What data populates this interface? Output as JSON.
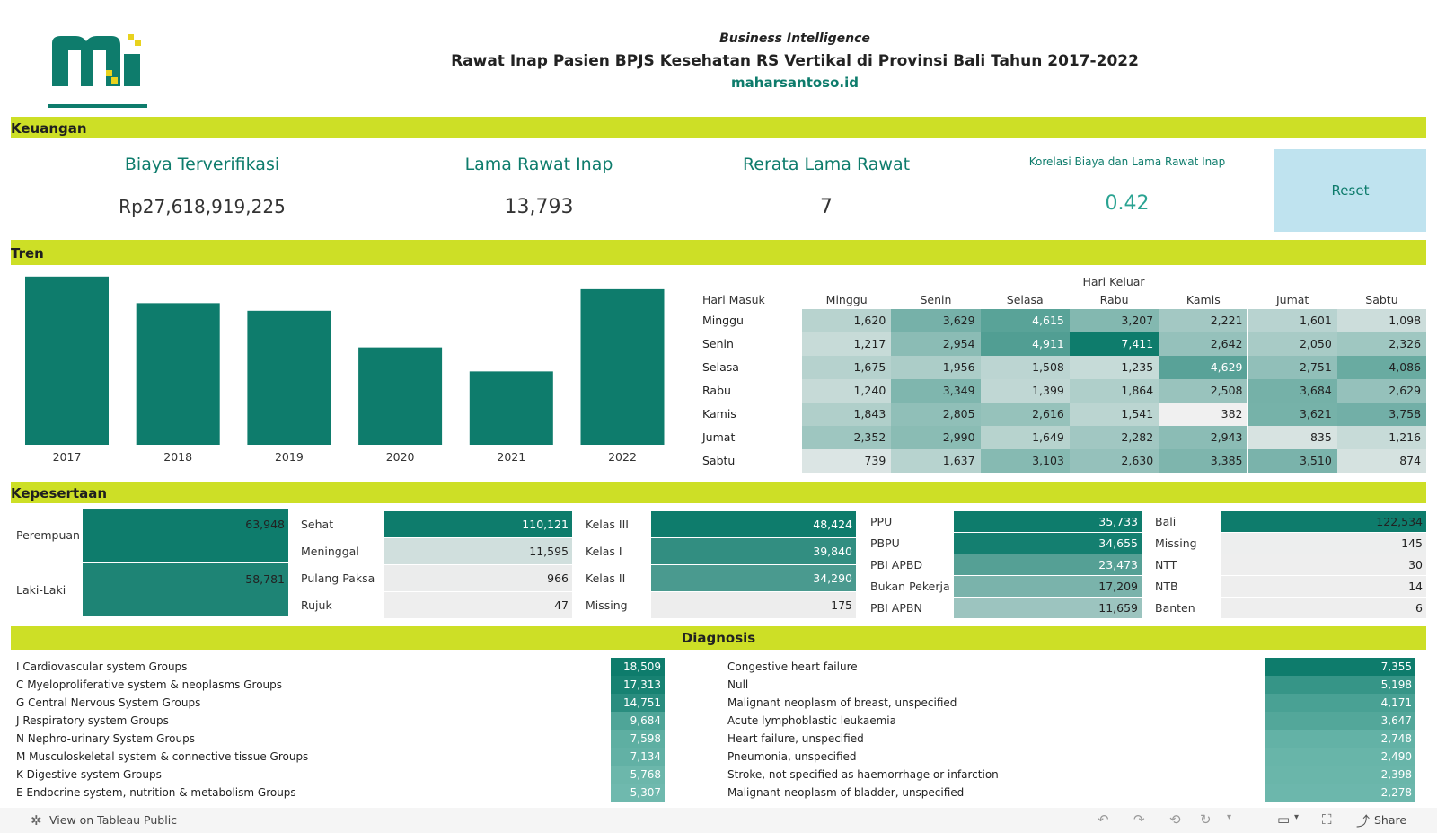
{
  "header": {
    "kicker": "Business Intelligence",
    "title": "Rawat Inap Pasien BPJS Kesehatan RS Vertikal di Provinsi Bali Tahun 2017-2022",
    "site": "maharsantoso.id"
  },
  "colors": {
    "accent": "#0e7c6c",
    "band": "#cddf26",
    "reset_bg": "#bfe3ef"
  },
  "sections": {
    "keuangan": "Keuangan",
    "tren": "Tren",
    "kepesertaan": "Kepesertaan",
    "diagnosis": "Diagnosis"
  },
  "kpi": {
    "biaya": {
      "label": "Biaya Terverifikasi",
      "value": "Rp27,618,919,225"
    },
    "lama": {
      "label": "Lama Rawat Inap",
      "value": "13,793"
    },
    "rerata": {
      "label": "Rerata Lama Rawat",
      "value": "7"
    },
    "korelasi": {
      "label": "Korelasi Biaya dan Lama Rawat Inap",
      "value": "0.42"
    },
    "reset": "Reset"
  },
  "chart_data": [
    {
      "type": "bar",
      "categories": [
        "2017",
        "2018",
        "2019",
        "2020",
        "2021",
        "2022"
      ],
      "values": [
        2660,
        2240,
        2120,
        1540,
        1160,
        2460
      ],
      "ylim": [
        0,
        2700
      ],
      "xlabel": "",
      "ylabel": ""
    },
    {
      "type": "heatmap",
      "title": "Hari Keluar",
      "ylabel": "Hari Masuk",
      "columns": [
        "Minggu",
        "Senin",
        "Selasa",
        "Rabu",
        "Kamis",
        "Jumat",
        "Sabtu"
      ],
      "rows": [
        "Minggu",
        "Senin",
        "Selasa",
        "Rabu",
        "Kamis",
        "Jumat",
        "Sabtu"
      ],
      "values": [
        [
          1620,
          3629,
          4615,
          3207,
          2221,
          1601,
          1098
        ],
        [
          1217,
          2954,
          4911,
          7411,
          2642,
          2050,
          2326
        ],
        [
          1675,
          1956,
          1508,
          1235,
          4629,
          2751,
          4086
        ],
        [
          1240,
          3349,
          1399,
          1864,
          2508,
          3684,
          2629
        ],
        [
          1843,
          2805,
          2616,
          1541,
          382,
          3621,
          3758
        ],
        [
          2352,
          2990,
          1649,
          2282,
          2943,
          835,
          1216
        ],
        [
          739,
          1637,
          3103,
          2630,
          3385,
          3510,
          874
        ]
      ],
      "labels": [
        [
          "1,620",
          "3,629",
          "4,615",
          "3,207",
          "2,221",
          "1,601",
          "1,098"
        ],
        [
          "1,217",
          "2,954",
          "4,911",
          "7,411",
          "2,642",
          "2,050",
          "2,326"
        ],
        [
          "1,675",
          "1,956",
          "1,508",
          "1,235",
          "4,629",
          "2,751",
          "4,086"
        ],
        [
          "1,240",
          "3,349",
          "1,399",
          "1,864",
          "2,508",
          "3,684",
          "2,629"
        ],
        [
          "1,843",
          "2,805",
          "2,616",
          "1,541",
          "382",
          "3,621",
          "3,758"
        ],
        [
          "2,352",
          "2,990",
          "1,649",
          "2,282",
          "2,943",
          "835",
          "1,216"
        ],
        [
          "739",
          "1,637",
          "3,103",
          "2,630",
          "3,385",
          "3,510",
          "874"
        ]
      ]
    }
  ],
  "kepesertaan": {
    "gender": [
      {
        "label": "Perempuan",
        "value": 63948,
        "text": "63,948"
      },
      {
        "label": "Laki-Laki",
        "value": 58781,
        "text": "58,781"
      }
    ],
    "status": [
      {
        "label": "Sehat",
        "value": 110121,
        "text": "110,121"
      },
      {
        "label": "Meninggal",
        "value": 11595,
        "text": "11,595"
      },
      {
        "label": "Pulang Paksa",
        "value": 966,
        "text": "966"
      },
      {
        "label": "Rujuk",
        "value": 47,
        "text": "47"
      }
    ],
    "kelas": [
      {
        "label": "Kelas III",
        "value": 48424,
        "text": "48,424"
      },
      {
        "label": "Kelas I",
        "value": 39840,
        "text": "39,840"
      },
      {
        "label": "Kelas II",
        "value": 34290,
        "text": "34,290"
      },
      {
        "label": "Missing",
        "value": 175,
        "text": "175"
      }
    ],
    "segmen": [
      {
        "label": "PPU",
        "value": 35733,
        "text": "35,733"
      },
      {
        "label": "PBPU",
        "value": 34655,
        "text": "34,655"
      },
      {
        "label": "PBI APBD",
        "value": 23473,
        "text": "23,473"
      },
      {
        "label": "Bukan Pekerja",
        "value": 17209,
        "text": "17,209"
      },
      {
        "label": "PBI APBN",
        "value": 11659,
        "text": "11,659"
      }
    ],
    "provinsi": [
      {
        "label": "Bali",
        "value": 122534,
        "text": "122,534"
      },
      {
        "label": "Missing",
        "value": 145,
        "text": "145"
      },
      {
        "label": "NTT",
        "value": 30,
        "text": "30"
      },
      {
        "label": "NTB",
        "value": 14,
        "text": "14"
      },
      {
        "label": "Banten",
        "value": 6,
        "text": "6"
      }
    ]
  },
  "diagnosis": {
    "groups": [
      {
        "label": "I Cardiovascular system Groups",
        "value": 18509,
        "text": "18,509"
      },
      {
        "label": "C Myeloproliferative system & neoplasms Groups",
        "value": 17313,
        "text": "17,313"
      },
      {
        "label": "G Central Nervous System Groups",
        "value": 14751,
        "text": "14,751"
      },
      {
        "label": "J Respiratory system Groups",
        "value": 9684,
        "text": "9,684"
      },
      {
        "label": "N Nephro-urinary System Groups",
        "value": 7598,
        "text": "7,598"
      },
      {
        "label": "M Musculoskeletal system & connective tissue Groups",
        "value": 7134,
        "text": "7,134"
      },
      {
        "label": "K Digestive system Groups",
        "value": 5768,
        "text": "5,768"
      },
      {
        "label": "E Endocrine system, nutrition & metabolism Groups",
        "value": 5307,
        "text": "5,307"
      }
    ],
    "items": [
      {
        "label": "Congestive heart failure",
        "value": 7355,
        "text": "7,355"
      },
      {
        "label": "Null",
        "value": 5198,
        "text": "5,198"
      },
      {
        "label": "Malignant neoplasm of breast, unspecified",
        "value": 4171,
        "text": "4,171"
      },
      {
        "label": "Acute lymphoblastic leukaemia",
        "value": 3647,
        "text": "3,647"
      },
      {
        "label": "Heart failure, unspecified",
        "value": 2748,
        "text": "2,748"
      },
      {
        "label": "Pneumonia, unspecified",
        "value": 2490,
        "text": "2,490"
      },
      {
        "label": "Stroke, not specified as haemorrhage or infarction",
        "value": 2398,
        "text": "2,398"
      },
      {
        "label": "Malignant neoplasm of bladder, unspecified",
        "value": 2278,
        "text": "2,278"
      }
    ]
  },
  "toolbar": {
    "view": "View on Tableau Public",
    "share": "Share"
  }
}
